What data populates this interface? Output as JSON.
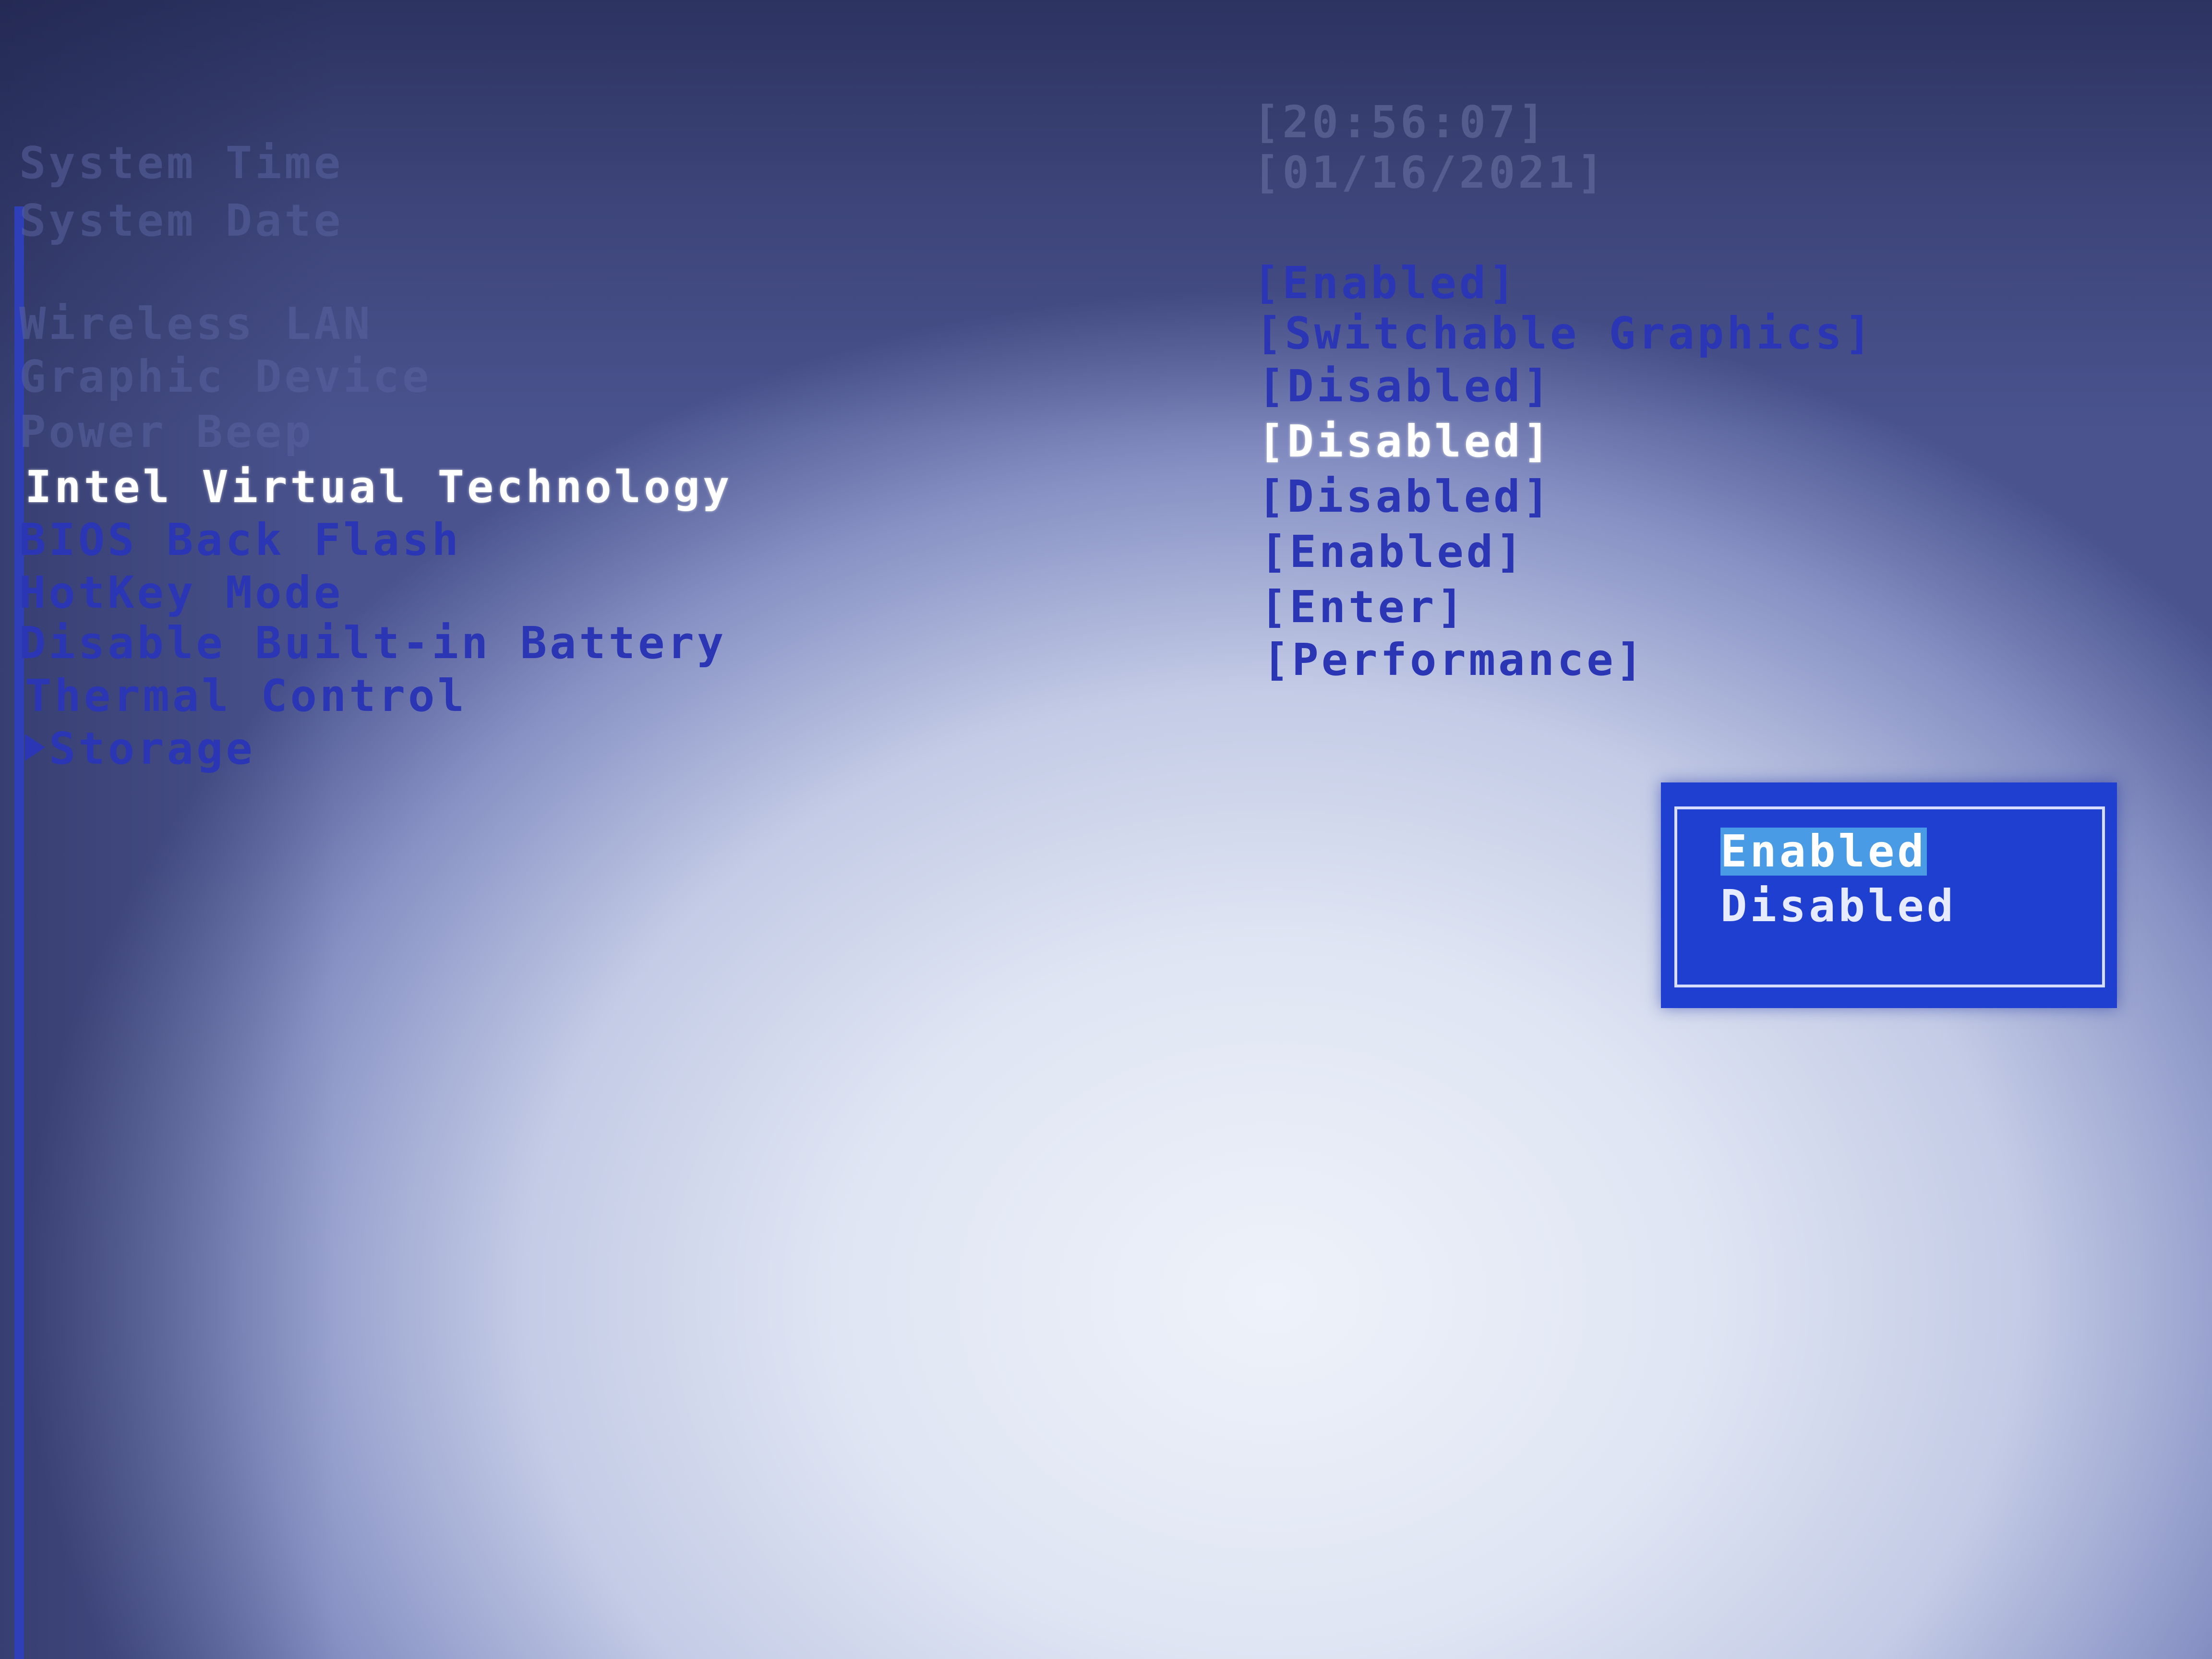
{
  "main": {
    "top_faded_labels": [
      "System Time",
      "System Date"
    ],
    "top_faded_values": [
      "[20:56:07]",
      "[01/16/2021]"
    ],
    "settings": [
      {
        "label": "Wireless LAN",
        "value": "[Enabled]"
      },
      {
        "label": "Graphic Device",
        "value": "[Switchable Graphics]"
      },
      {
        "label": "Power Beep",
        "value": "[Disabled]"
      },
      {
        "label": "Intel Virtual Technology",
        "value": "[Disabled]"
      },
      {
        "label": "BIOS Back Flash",
        "value": "[Disabled]"
      },
      {
        "label": "HotKey Mode",
        "value": "[Enabled]"
      },
      {
        "label": "Disable Built-in Battery",
        "value": "[Enter]"
      },
      {
        "label": "Thermal Control",
        "value": "[Performance]"
      },
      {
        "label": "Storage",
        "value": ""
      }
    ],
    "selected_setting": "Intel Virtual Technology"
  },
  "popup": {
    "options": [
      "Enabled",
      "Disabled"
    ],
    "selected": "Enabled"
  },
  "colors": {
    "text_blue": "#2a36b4",
    "highlight_white": "#ffffff",
    "popup_blue": "#1f3fd0",
    "popup_selection": "#4a9be6"
  }
}
